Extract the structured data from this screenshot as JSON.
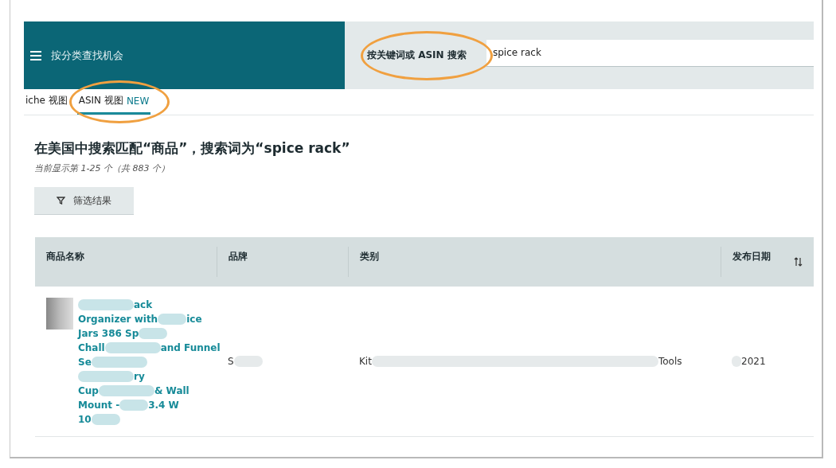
{
  "header": {
    "menu_label": "按分类查找机会",
    "search": {
      "label": "按关键词或 ASIN 搜索",
      "highlighted": true,
      "value": "spice rack"
    }
  },
  "tabs": [
    {
      "label": "iche 视图",
      "selected": false,
      "highlighted": false
    },
    {
      "label": "ASIN 视图",
      "badge": "NEW",
      "selected": true,
      "highlighted": true
    }
  ],
  "results": {
    "title": "在美国中搜索匹配“商品”，搜索词为“spice rack”",
    "subtitle": "当前显示第 1-25 个（共 883 个）",
    "filter_button": "筛选结果"
  },
  "table": {
    "columns": [
      {
        "label": "商品名称",
        "sortable": false
      },
      {
        "label": "品牌",
        "sortable": false
      },
      {
        "label": "类别",
        "sortable": false
      },
      {
        "label": "发布日期",
        "sortable": true
      }
    ],
    "rows": [
      {
        "product_lines": [
          [
            {
              "kind": "long_redaction"
            },
            {
              "kind": "text",
              "text": "ack"
            }
          ],
          [
            {
              "kind": "text",
              "text": "Organizer with"
            },
            {
              "kind": "redaction"
            },
            {
              "kind": "text",
              "text": "ice"
            }
          ],
          [
            {
              "kind": "text",
              "text": "Jars 386 Sp"
            },
            {
              "kind": "redaction"
            }
          ],
          [
            {
              "kind": "text",
              "text": "Chall"
            },
            {
              "kind": "long_redaction"
            },
            {
              "kind": "text",
              "text": "and Funnel"
            }
          ],
          [
            {
              "kind": "text",
              "text": "Se"
            },
            {
              "kind": "long_redaction"
            }
          ],
          [
            {
              "kind": "long_redaction"
            },
            {
              "kind": "text",
              "text": "ry"
            }
          ],
          [
            {
              "kind": "text",
              "text": "Cup"
            },
            {
              "kind": "long_redaction"
            },
            {
              "kind": "text",
              "text": "& Wall"
            }
          ],
          [
            {
              "kind": "text",
              "text": "Mount -"
            },
            {
              "kind": "redaction"
            },
            {
              "kind": "text",
              "text": "3.4 W"
            }
          ],
          [
            {
              "kind": "text",
              "text": "10"
            },
            {
              "kind": "redaction"
            }
          ]
        ],
        "brand": [
          {
            "kind": "text",
            "text": "S"
          },
          {
            "kind": "redaction"
          }
        ],
        "category": [
          {
            "kind": "text",
            "text": "Kit"
          },
          {
            "kind": "wide_redaction"
          },
          {
            "kind": "text",
            "text": "Tools"
          }
        ],
        "date": [
          {
            "kind": "small_redaction"
          },
          {
            "kind": "text",
            "text": "2021"
          }
        ]
      }
    ]
  }
}
